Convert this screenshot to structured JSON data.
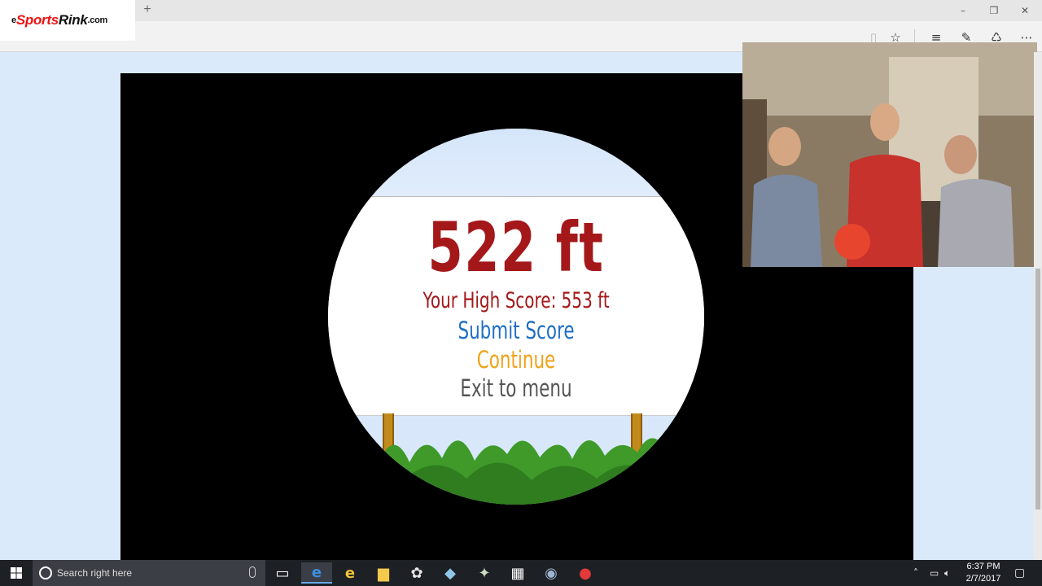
{
  "browser": {
    "new_tab_label": "+",
    "window_controls": {
      "minimize": "–",
      "restore": "❐",
      "close": "✕"
    },
    "logo": {
      "prefix": "e",
      "brand_red": "Sports",
      "brand_dark": "Rink",
      "suffix": ".com"
    },
    "toolbar_icons": [
      "reading-view-icon",
      "favorite-star-icon",
      "hub-icon",
      "web-note-icon",
      "share-icon",
      "more-icon"
    ]
  },
  "game": {
    "score": "522 ft",
    "high_score": "Your High Score: 553 ft",
    "menu": {
      "submit": "Submit Score",
      "continue": "Continue",
      "exit": "Exit to menu"
    },
    "colors": {
      "score": "#a4181a",
      "submit": "#1f6fc4",
      "continue": "#f0a218",
      "exit": "#555555",
      "grass": "#3f9a2a",
      "post": "#c18a1a"
    }
  },
  "taskbar": {
    "search_placeholder": "Search right here",
    "apps": [
      "task-view-icon",
      "edge-icon",
      "internet-explorer-icon",
      "file-explorer-icon",
      "paint-icon",
      "app-icon",
      "app-icon-2",
      "calculator-icon",
      "steam-icon",
      "record-icon"
    ],
    "clock": {
      "time": "6:37 PM",
      "date": "2/7/2017"
    }
  }
}
